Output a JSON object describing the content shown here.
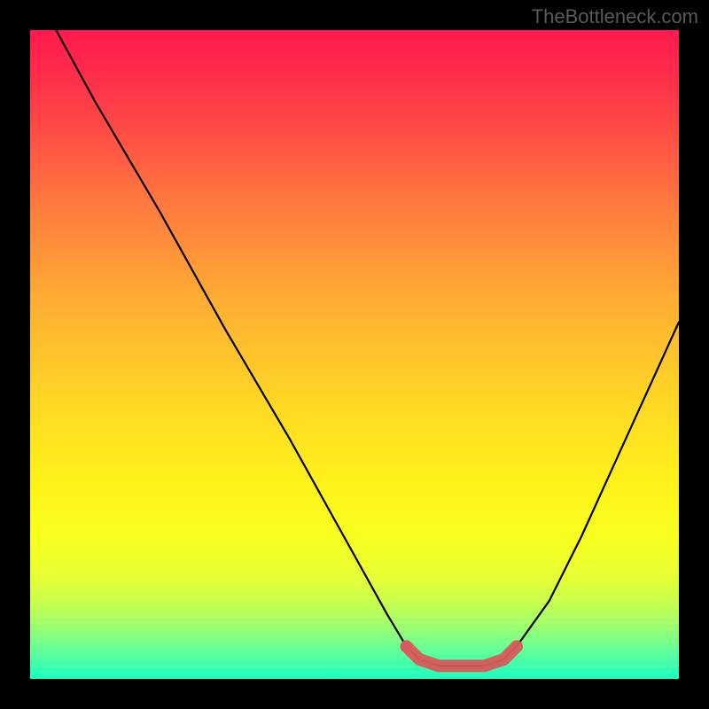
{
  "watermark": "TheBottleneck.com",
  "chart_data": {
    "type": "line",
    "title": "",
    "xlabel": "",
    "ylabel": "",
    "xlim": [
      0,
      100
    ],
    "ylim": [
      0,
      100
    ],
    "series": [
      {
        "name": "curve",
        "x": [
          4,
          10,
          20,
          30,
          40,
          50,
          55,
          58,
          60,
          63,
          66,
          70,
          73,
          75,
          80,
          85,
          90,
          95,
          100
        ],
        "y": [
          100,
          89,
          72,
          54,
          37,
          19,
          10,
          5,
          3,
          2,
          2,
          2,
          3,
          5,
          12,
          22,
          33,
          44,
          55
        ]
      }
    ],
    "highlight_segment": {
      "name": "flat-bottom",
      "color": "#d85a5a",
      "x": [
        58,
        60,
        63,
        66,
        70,
        73,
        75
      ],
      "y": [
        5,
        3,
        2,
        2,
        2,
        3,
        5
      ]
    },
    "highlight_dot": {
      "x": 58,
      "y": 5,
      "color": "#d85a5a"
    },
    "background": "rainbow-red-to-green-vertical"
  }
}
